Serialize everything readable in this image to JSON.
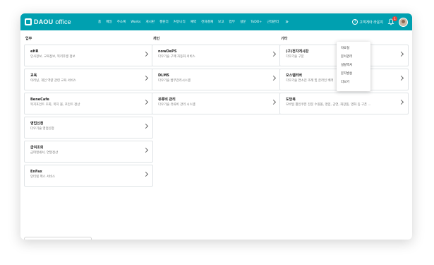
{
  "header": {
    "logo_brand": "DAOU",
    "logo_product": "office",
    "nav": [
      "홈",
      "메일",
      "주소록",
      "Works",
      "게시판",
      "캘린더",
      "커뮤니티",
      "예약",
      "전자결재",
      "보고",
      "업무",
      "설문",
      "ToDO+",
      "근태관리"
    ],
    "more": "»",
    "help_label": "고객게아 라운지",
    "help_icon": "?",
    "notification_count": "1"
  },
  "dropdown": [
    "자료실",
    "문서관리",
    "설탈백서",
    "문자발송",
    "더보기"
  ],
  "columns": [
    {
      "title": "업무",
      "cards": [
        {
          "title": "eHR",
          "desc": "인사정보, 교육정보, 복리후생 정보"
        },
        {
          "title": "교육",
          "desc": "이러닝, 개인 역량 관련 교육 서비스"
        },
        {
          "title": "BeneCafe",
          "desc": "복지포인트 조회, 복지 몰, 포인트 정산"
        },
        {
          "title": "영업신청",
          "desc": "다우기술 영업신청"
        },
        {
          "title": "급여조회",
          "desc": "급여명세서, 연말정산"
        },
        {
          "title": "EnFax",
          "desc": "인터넷 팩스 서비스"
        }
      ]
    },
    {
      "title": "개인",
      "cards": [
        {
          "title": "nowDePS",
          "desc": "다우기술 구매 자동화 서비스"
        },
        {
          "title": "DLMS",
          "desc": "다우기술 법무관리시스템"
        },
        {
          "title": "유류비 관리",
          "desc": "다우기술 유류비 관리 시스템"
        }
      ]
    },
    {
      "title": "기타",
      "cards": [
        {
          "title": "(구)전자게시판",
          "desc": "다우기술 구문"
        },
        {
          "title": "오스템리버",
          "desc": "다우기술 연소전 조례 및 온라인 배려"
        },
        {
          "title": "도당북",
          "desc": "모바일 활인쿠폰 전문 수원몰, 명임, 공연, 화장품, 영화 등 구픈 ..."
        }
      ]
    }
  ],
  "search": {
    "placeholder": "이름/아이디/부서/직위/직책/..."
  }
}
